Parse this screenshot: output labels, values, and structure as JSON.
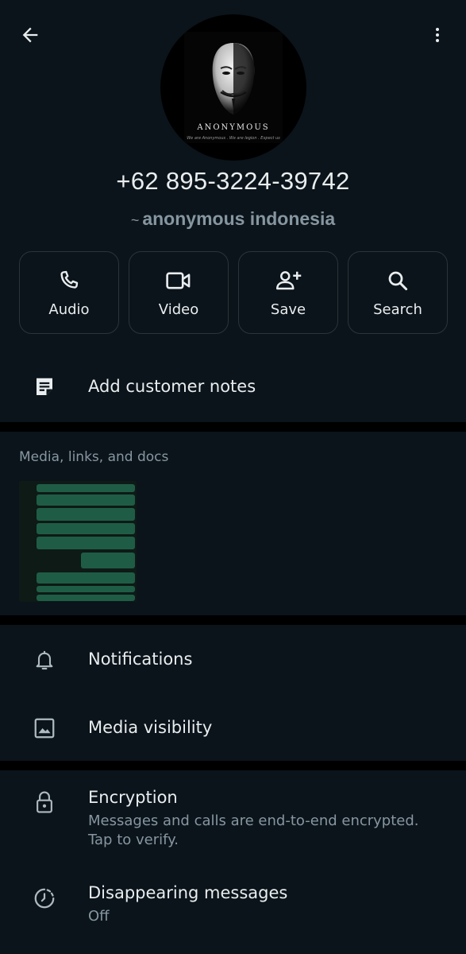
{
  "contact": {
    "phone": "+62 895-3224-39742",
    "tilde": "~",
    "push_name": "anonymous indonesia"
  },
  "avatar": {
    "title": "ANONYMOUS",
    "subtitle": "We are Anonymous . We are legion . Expect us"
  },
  "actions": [
    {
      "label": "Audio",
      "icon": "phone-icon"
    },
    {
      "label": "Video",
      "icon": "video-icon"
    },
    {
      "label": "Save",
      "icon": "add-person-icon"
    },
    {
      "label": "Search",
      "icon": "search-icon"
    }
  ],
  "notes": {
    "label": "Add customer notes",
    "icon": "note-icon"
  },
  "media": {
    "title": "Media, links, and docs"
  },
  "settings": {
    "notifications": "Notifications",
    "media_visibility": "Media visibility",
    "encryption_title": "Encryption",
    "encryption_sub": "Messages and calls are end-to-end encrypted. Tap to verify.",
    "disappearing_title": "Disappearing messages",
    "disappearing_sub": "Off"
  },
  "colors": {
    "background": "#0b141a",
    "primary_text": "#e9edef",
    "secondary_text": "#8696a0",
    "separator": "#000000"
  }
}
